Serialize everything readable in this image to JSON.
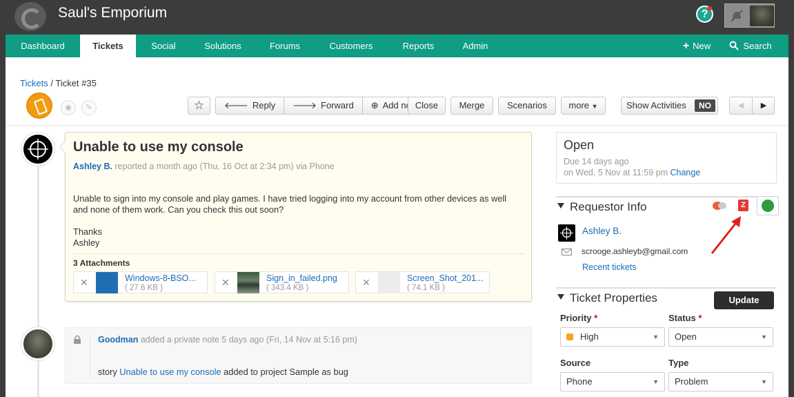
{
  "app": {
    "title": "Saul's Emporium",
    "help_label": "?"
  },
  "nav": {
    "items": [
      {
        "label": "Dashboard"
      },
      {
        "label": "Tickets"
      },
      {
        "label": "Social"
      },
      {
        "label": "Solutions"
      },
      {
        "label": "Forums"
      },
      {
        "label": "Customers"
      },
      {
        "label": "Reports"
      },
      {
        "label": "Admin"
      }
    ],
    "active": "Tickets",
    "new_label": "New",
    "search_label": "Search"
  },
  "breadcrumb": {
    "root": "Tickets",
    "separator": "/",
    "current": "Ticket #35"
  },
  "toolbar": {
    "reply": "Reply",
    "forward": "Forward",
    "add_note": "Add note",
    "close": "Close",
    "merge": "Merge",
    "scenarios": "Scenarios",
    "more": "more",
    "show_activities": "Show Activities",
    "show_activities_state": "NO"
  },
  "ticket": {
    "subject": "Unable to use my console",
    "requester": "Ashley B.",
    "meta": "reported a month ago (Thu, 16 Oct at 2:34 pm) via Phone",
    "body_line1": "Unable to sign into my console and play games. I have tried logging into my account from other devices as well",
    "body_line2": "and none of them work. Can you check this out soon?",
    "sign_1": "Thanks",
    "sign_2": "Ashley",
    "attachments_title": "3 Attachments",
    "attachments": [
      {
        "name": "Windows-8-BSO...",
        "size": "( 27.6 KB )"
      },
      {
        "name": "Sign_in_failed.png",
        "size": "( 343.4 KB )"
      },
      {
        "name": "Screen_Shot_201...",
        "size": "( 74.1 KB )"
      }
    ]
  },
  "note": {
    "author": "Goodman",
    "meta": "added a private note 5 days ago (Fri, 14 Nov at 5:16 pm)",
    "text_prefix": "story",
    "link": "Unable to use my console",
    "text_suffix": "added to project Sample as bug"
  },
  "status": {
    "state": "Open",
    "due": "Due 14 days ago",
    "due_on": "on Wed, 5 Nov at 11:59 pm",
    "change_label": "Change"
  },
  "requestor": {
    "section_title": "Requestor Info",
    "name": "Ashley B.",
    "email": "scrooge.ashleyb@gmail.com",
    "recent_tickets": "Recent tickets"
  },
  "properties": {
    "section_title": "Ticket Properties",
    "update_label": "Update",
    "priority_label": "Priority",
    "priority_value": "High",
    "status_label": "Status",
    "status_value": "Open",
    "source_label": "Source",
    "source_value": "Phone",
    "type_label": "Type",
    "type_value": "Problem",
    "required_mark": "*"
  },
  "colors": {
    "nav_bg": "#0f9d84",
    "topbar_bg": "#3c3c3c",
    "link": "#1c6bb8",
    "card_bg": "#fffdf0",
    "priority_high": "#f5a623"
  }
}
